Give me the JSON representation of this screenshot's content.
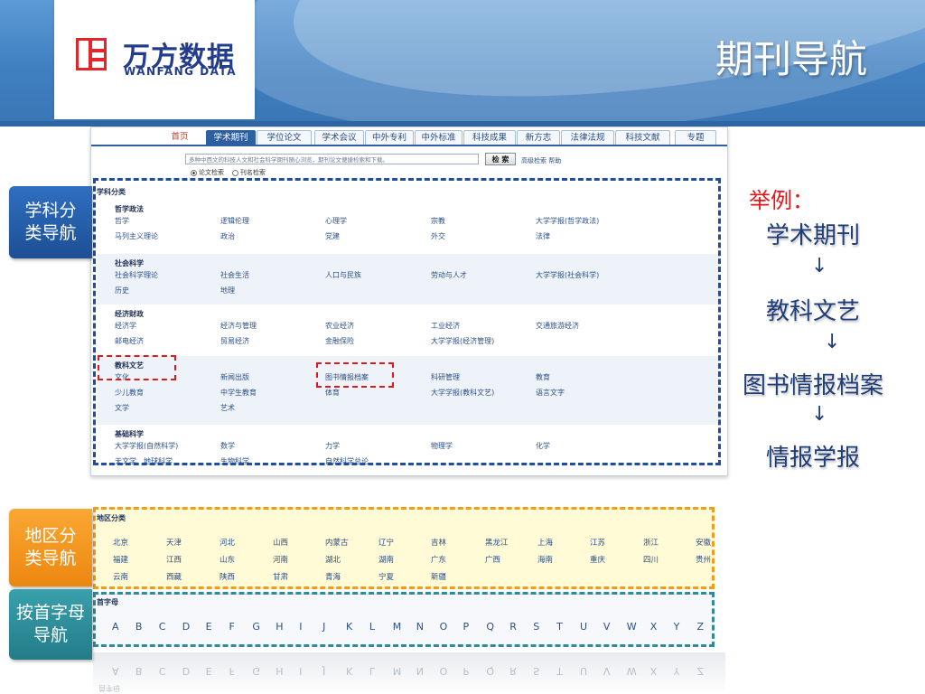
{
  "slide": {
    "title": "期刊导航",
    "logo_cn": "万方数据",
    "logo_en": "WANFANG DATA"
  },
  "nav": {
    "tabs": [
      "首页",
      "学术期刊",
      "学位论文",
      "学术会议",
      "中外专利",
      "中外标准",
      "科技成果",
      "新方志",
      "法律法规",
      "科技文献",
      "专题"
    ],
    "active_index": 1
  },
  "search": {
    "placeholder": "多种中西文的科技人文和社会科学期刊随心浏览，期刊论文便捷检索和下载。",
    "button": "检 索",
    "advanced": "高级检索",
    "help": "帮助",
    "radio_1": "论文检索",
    "radio_2": "刊名检索"
  },
  "subjects": {
    "heading": "学科分类",
    "sections": [
      {
        "title": "哲学政法",
        "rows": [
          [
            "哲学",
            "逻辑伦理",
            "心理学",
            "宗教",
            "大学学报(哲学政法)"
          ],
          [
            "马列主义理论",
            "政治",
            "党建",
            "外交",
            "法律"
          ]
        ]
      },
      {
        "title": "社会科学",
        "rows": [
          [
            "社会科学理论",
            "社会生活",
            "人口与民族",
            "劳动与人才",
            "大学学报(社会科学)"
          ],
          [
            "历史",
            "地理",
            "",
            "",
            ""
          ]
        ]
      },
      {
        "title": "经济财政",
        "rows": [
          [
            "经济学",
            "经济与管理",
            "农业经济",
            "工业经济",
            "交通旅游经济"
          ],
          [
            "邮电经济",
            "贸易经济",
            "金融保险",
            "大学学报(经济管理)",
            ""
          ]
        ]
      },
      {
        "title": "教科文艺",
        "rows": [
          [
            "文化",
            "新闻出版",
            "图书情报档案",
            "科研管理",
            "教育"
          ],
          [
            "少儿教育",
            "中学生教育",
            "体育",
            "大学学报(教科文艺)",
            "语言文字"
          ],
          [
            "文学",
            "艺术",
            "",
            "",
            ""
          ]
        ]
      },
      {
        "title": "基础科学",
        "rows": [
          [
            "大学学报(自然科学)",
            "数学",
            "力学",
            "物理学",
            "化学"
          ],
          [
            "天文学、地球科学",
            "生物科学",
            "自然科学总论",
            "",
            ""
          ]
        ]
      }
    ]
  },
  "regions": {
    "heading": "地区分类",
    "rows": [
      [
        "北京",
        "天津",
        "河北",
        "山西",
        "内蒙古",
        "辽宁",
        "吉林",
        "黑龙江",
        "上海",
        "江苏",
        "浙江",
        "安徽"
      ],
      [
        "福建",
        "江西",
        "山东",
        "河南",
        "湖北",
        "湖南",
        "广东",
        "广西",
        "海南",
        "重庆",
        "四川",
        "贵州"
      ],
      [
        "云南",
        "西藏",
        "陕西",
        "甘肃",
        "青海",
        "宁夏",
        "新疆",
        "",
        "",
        "",
        "",
        ""
      ]
    ]
  },
  "letters": {
    "heading": "首字母",
    "items": [
      "A",
      "B",
      "C",
      "D",
      "E",
      "F",
      "G",
      "H",
      "I",
      "J",
      "K",
      "L",
      "M",
      "N",
      "O",
      "P",
      "Q",
      "R",
      "S",
      "T",
      "U",
      "V",
      "W",
      "X",
      "Y",
      "Z"
    ]
  },
  "tags": {
    "subject": "学科分类导航",
    "region": "地区分类导航",
    "letter": "按首字母导航"
  },
  "example": {
    "title": "举例：",
    "lines": [
      "学术期刊",
      "教科文艺",
      "图书情报档案",
      "情报学报"
    ],
    "arrow": "↓"
  },
  "colors": {
    "header_blue": "#3f7fc0",
    "highlight_blue": "#1f4ea0",
    "highlight_red": "#e3171b",
    "highlight_orange": "#f39b1c",
    "highlight_teal": "#2e8b9b"
  }
}
